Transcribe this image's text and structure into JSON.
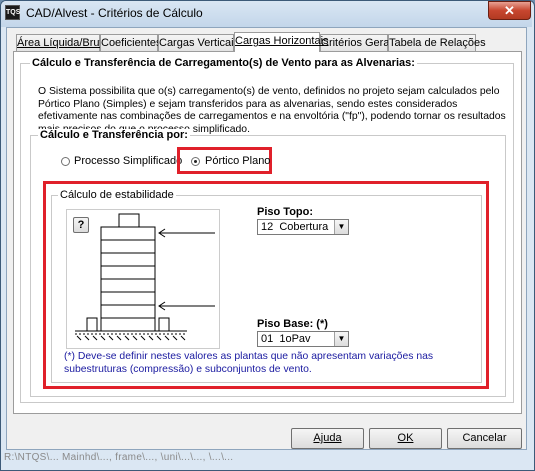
{
  "window": {
    "title": "CAD/Alvest - Critérios de Cálculo",
    "icon_label": "TQS",
    "close_glyph": "✕"
  },
  "tabs": [
    {
      "label": "Área Líquida/Bruta",
      "active": false
    },
    {
      "label": "Coeficientes",
      "active": false
    },
    {
      "label": "Cargas Verticais",
      "active": false
    },
    {
      "label": "Cargas Horizontais",
      "active": true
    },
    {
      "label": "Critérios Gerais",
      "active": false
    },
    {
      "label": "Tabela de Relações",
      "active": false
    }
  ],
  "section": {
    "title": "Cálculo e Transferência de Carregamento(s) de Vento para as Alvenarias:",
    "description": "O Sistema possibilita que o(s) carregamento(s) de vento, definidos no projeto sejam calculados pelo Pórtico Plano (Simples) e sejam transferidos para as alvenarias, sendo estes considerados efetivamente nas combinações de carregamentos e na envoltória (\"fp\"), podendo tornar os resultados mais precisos do que o processo simplificado."
  },
  "calc_group": {
    "title": "Cálculo e Transferência por:",
    "options": [
      {
        "label": "Processo Simplificado",
        "selected": false
      },
      {
        "label": "Pórtico Plano",
        "selected": true
      }
    ]
  },
  "stability": {
    "title": "Cálculo de estabilidade",
    "help_label": "?",
    "piso_topo": {
      "label": "Piso Topo:",
      "value": "12  Cobertura"
    },
    "piso_base": {
      "label": "Piso Base: (*)",
      "value": "01  1oPav"
    },
    "note": "(*) Deve-se definir nestes valores as plantas que não apresentam variações nas subestruturas (compressão) e subconjuntos de vento.",
    "note_color": "#1a1aa0"
  },
  "buttons": {
    "help": "Ajuda",
    "ok": "OK",
    "cancel": "Cancelar"
  },
  "status_text": "R:\\NTQS\\... Mainhd\\..., frame\\..., \\uni\\...\\..., \\...\\..."
}
